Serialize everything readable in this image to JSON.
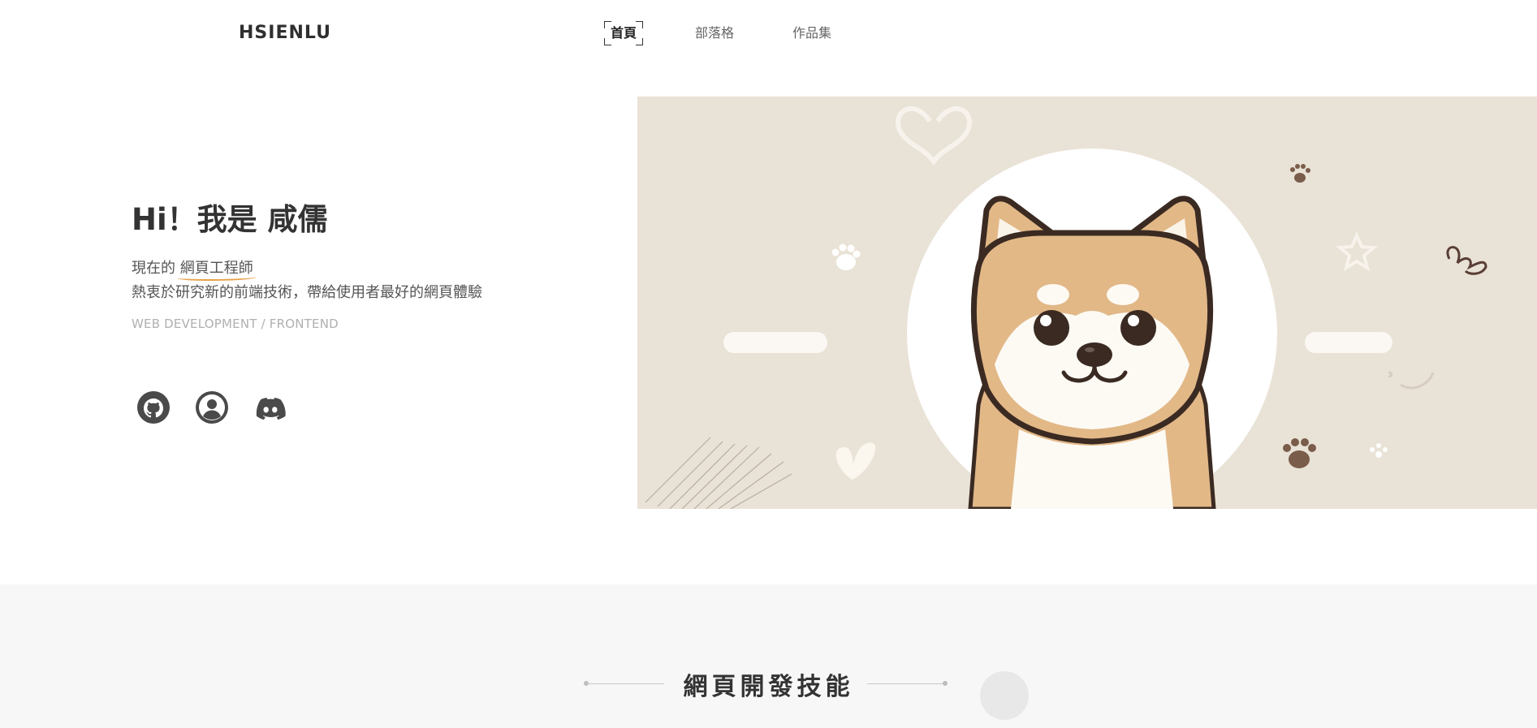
{
  "header": {
    "logo": "HSIENLU",
    "nav": [
      {
        "label": "首頁",
        "active": true
      },
      {
        "label": "部落格",
        "active": false
      },
      {
        "label": "作品集",
        "active": false
      }
    ]
  },
  "hero": {
    "title": "Hi！我是 咸儒",
    "line1_prefix": "現在的 ",
    "line1_highlight": "網頁工程師",
    "line2": "熱衷於研究新的前端技術，帶給使用者最好的網頁體驗",
    "subtitle": "WEB DEVELOPMENT / FRONTEND",
    "socials": [
      {
        "icon": "github-icon"
      },
      {
        "icon": "user-circle-icon"
      },
      {
        "icon": "discord-icon"
      }
    ]
  },
  "skills": {
    "title": "網頁開發技能"
  },
  "colors": {
    "accent_underline": "#e5a14a",
    "hero_bg": "#e9e2d6",
    "section_bg": "#f7f7f7"
  }
}
